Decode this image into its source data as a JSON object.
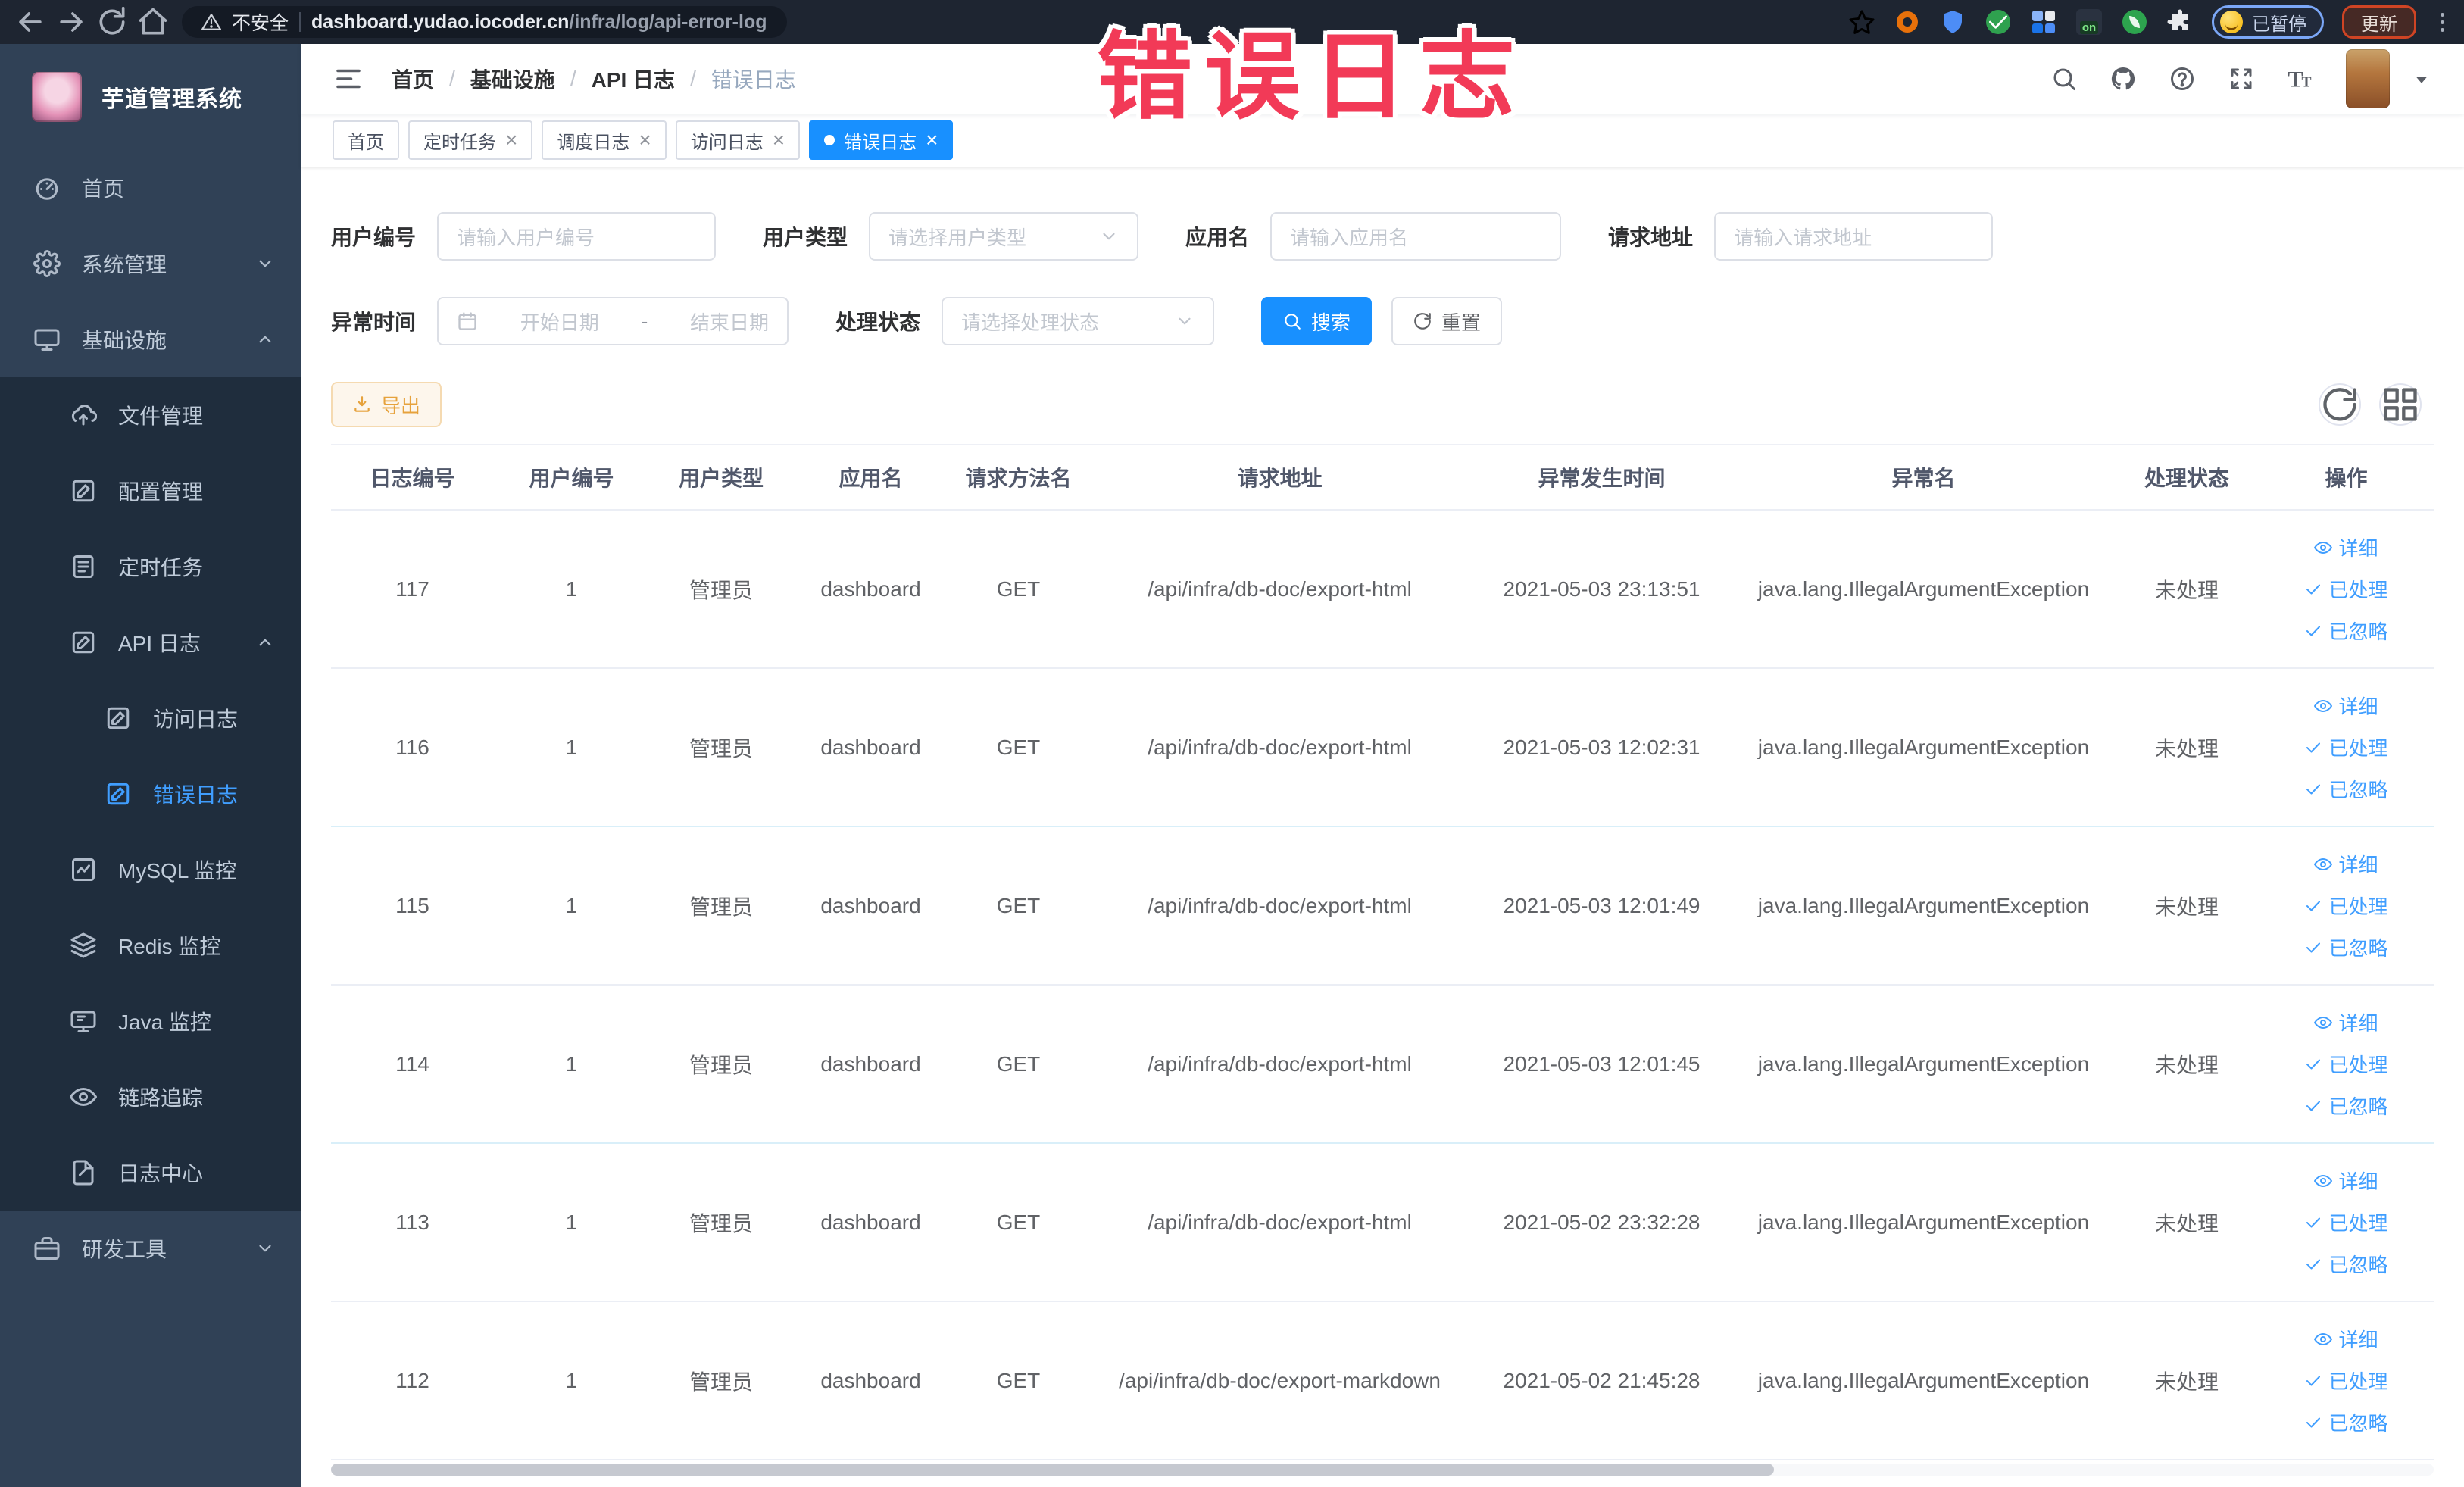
{
  "browser": {
    "security_label": "不安全",
    "url_host": "dashboard.yudao.iocoder.cn",
    "url_path": "/infra/log/api-error-log",
    "ext_on_label": "on",
    "paused_badge": "已暂停",
    "update_button": "更新"
  },
  "annotation": "错误日志",
  "sidebar": {
    "title": "芋道管理系统",
    "items": [
      {
        "label": "首页",
        "icon": "gauge",
        "depth": 0,
        "sub": false,
        "active": false,
        "chevron": null
      },
      {
        "label": "系统管理",
        "icon": "gear",
        "depth": 0,
        "sub": false,
        "active": false,
        "chevron": "down"
      },
      {
        "label": "基础设施",
        "icon": "monitor",
        "depth": 0,
        "sub": false,
        "active": false,
        "chevron": "up"
      },
      {
        "label": "文件管理",
        "icon": "cloud-up",
        "depth": 1,
        "sub": true,
        "active": false,
        "chevron": null
      },
      {
        "label": "配置管理",
        "icon": "edit-square",
        "depth": 1,
        "sub": true,
        "active": false,
        "chevron": null
      },
      {
        "label": "定时任务",
        "icon": "schedule",
        "depth": 1,
        "sub": true,
        "active": false,
        "chevron": null
      },
      {
        "label": "API 日志",
        "icon": "edit-square",
        "depth": 1,
        "sub": true,
        "active": false,
        "chevron": "up"
      },
      {
        "label": "访问日志",
        "icon": "edit-square",
        "depth": 2,
        "sub": true,
        "active": false,
        "chevron": null
      },
      {
        "label": "错误日志",
        "icon": "edit-square",
        "depth": 2,
        "sub": true,
        "active": true,
        "chevron": null
      },
      {
        "label": "MySQL 监控",
        "icon": "chart",
        "depth": 1,
        "sub": true,
        "active": false,
        "chevron": null
      },
      {
        "label": "Redis 监控",
        "icon": "layers",
        "depth": 1,
        "sub": true,
        "active": false,
        "chevron": null
      },
      {
        "label": "Java 监控",
        "icon": "java-monitor",
        "depth": 1,
        "sub": true,
        "active": false,
        "chevron": null
      },
      {
        "label": "链路追踪",
        "icon": "eye",
        "depth": 1,
        "sub": true,
        "active": false,
        "chevron": null
      },
      {
        "label": "日志中心",
        "icon": "doc-edit",
        "depth": 1,
        "sub": true,
        "active": false,
        "chevron": null
      },
      {
        "label": "研发工具",
        "icon": "briefcase",
        "depth": 0,
        "sub": false,
        "active": false,
        "chevron": "down"
      }
    ]
  },
  "breadcrumb": [
    "首页",
    "基础设施",
    "API 日志",
    "错误日志"
  ],
  "tabs": [
    {
      "label": "首页",
      "closable": false,
      "active": false
    },
    {
      "label": "定时任务",
      "closable": true,
      "active": false
    },
    {
      "label": "调度日志",
      "closable": true,
      "active": false
    },
    {
      "label": "访问日志",
      "closable": true,
      "active": false
    },
    {
      "label": "错误日志",
      "closable": true,
      "active": true
    }
  ],
  "filters": {
    "user_id": {
      "label": "用户编号",
      "placeholder": "请输入用户编号"
    },
    "user_type": {
      "label": "用户类型",
      "placeholder": "请选择用户类型"
    },
    "app_name": {
      "label": "应用名",
      "placeholder": "请输入应用名"
    },
    "request_url": {
      "label": "请求地址",
      "placeholder": "请输入请求地址"
    },
    "exception_time": {
      "label": "异常时间",
      "start_placeholder": "开始日期",
      "separator": "-",
      "end_placeholder": "结束日期"
    },
    "process_status": {
      "label": "处理状态",
      "placeholder": "请选择处理状态"
    },
    "search_button": "搜索",
    "reset_button": "重置"
  },
  "toolbar": {
    "export_button": "导出"
  },
  "table": {
    "columns": [
      "日志编号",
      "用户编号",
      "用户类型",
      "应用名",
      "请求方法名",
      "请求地址",
      "异常发生时间",
      "异常名",
      "处理状态",
      "操作"
    ],
    "row_actions": [
      {
        "label": "详细",
        "icon": "eye"
      },
      {
        "label": "已处理",
        "icon": "check"
      },
      {
        "label": "已忽略",
        "icon": "check"
      }
    ],
    "rows": [
      {
        "id": "117",
        "user_id": "1",
        "user_type": "管理员",
        "app": "dashboard",
        "method": "GET",
        "url": "/api/infra/db-doc/export-html",
        "time": "2021-05-03 23:13:51",
        "exception": "java.lang.IllegalArgumentException",
        "status": "未处理"
      },
      {
        "id": "116",
        "user_id": "1",
        "user_type": "管理员",
        "app": "dashboard",
        "method": "GET",
        "url": "/api/infra/db-doc/export-html",
        "time": "2021-05-03 12:02:31",
        "exception": "java.lang.IllegalArgumentException",
        "status": "未处理"
      },
      {
        "id": "115",
        "user_id": "1",
        "user_type": "管理员",
        "app": "dashboard",
        "method": "GET",
        "url": "/api/infra/db-doc/export-html",
        "time": "2021-05-03 12:01:49",
        "exception": "java.lang.IllegalArgumentException",
        "status": "未处理"
      },
      {
        "id": "114",
        "user_id": "1",
        "user_type": "管理员",
        "app": "dashboard",
        "method": "GET",
        "url": "/api/infra/db-doc/export-html",
        "time": "2021-05-03 12:01:45",
        "exception": "java.lang.IllegalArgumentException",
        "status": "未处理"
      },
      {
        "id": "113",
        "user_id": "1",
        "user_type": "管理员",
        "app": "dashboard",
        "method": "GET",
        "url": "/api/infra/db-doc/export-html",
        "time": "2021-05-02 23:32:28",
        "exception": "java.lang.IllegalArgumentException",
        "status": "未处理"
      },
      {
        "id": "112",
        "user_id": "1",
        "user_type": "管理员",
        "app": "dashboard",
        "method": "GET",
        "url": "/api/infra/db-doc/export-markdown",
        "time": "2021-05-02 21:45:28",
        "exception": "java.lang.IllegalArgumentException",
        "status": "未处理"
      }
    ]
  },
  "colors": {
    "accent": "#1890ff",
    "link": "#409eff",
    "sidebar_bg": "#304156",
    "submenu_bg": "#1f2d3d",
    "warning": "#e6a23c",
    "annotation": "#f23a57"
  }
}
